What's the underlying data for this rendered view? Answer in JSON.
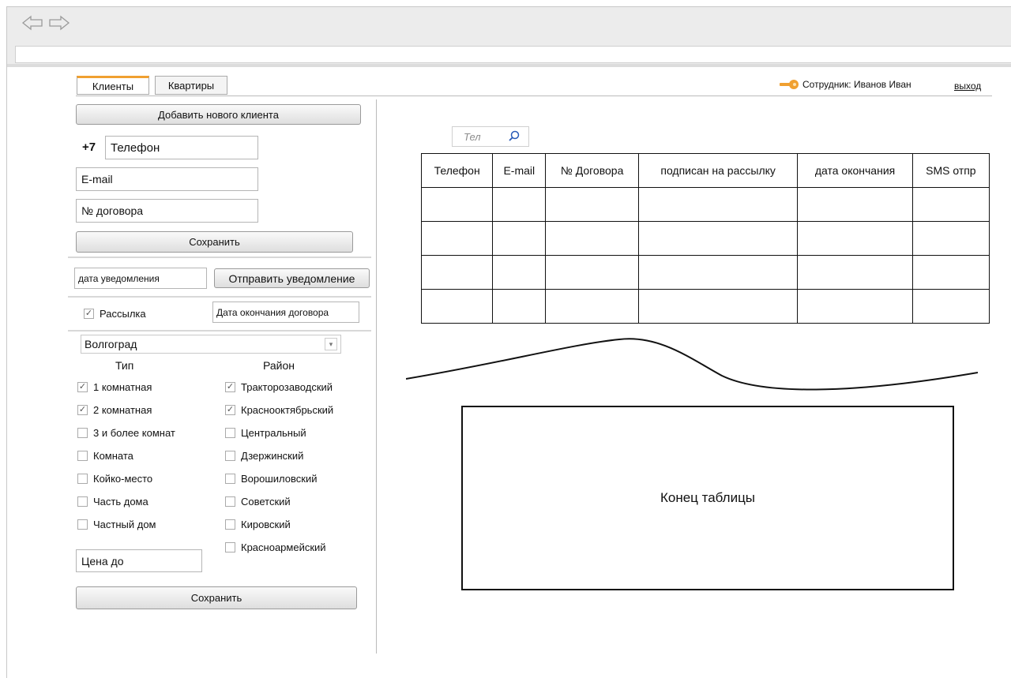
{
  "tabs": {
    "clients": "Клиенты",
    "apartments": "Квартиры"
  },
  "header": {
    "employee": "Сотрудник: Иванов Иван",
    "logout": "выход"
  },
  "client_form": {
    "add_button": "Добавить нового клиента",
    "phone_prefix": "+7",
    "phone_placeholder": "Телефон",
    "email_placeholder": "E-mail",
    "contract_placeholder": "№ договора",
    "save_button": "Сохранить"
  },
  "notify": {
    "date_placeholder": "дата уведомления",
    "send_button": "Отправить уведомление",
    "newsletter_label": "Рассылка",
    "newsletter_checked": true,
    "contract_end_placeholder": "Дата окончания договора"
  },
  "filters": {
    "city": "Волгоград",
    "type_header": "Тип",
    "district_header": "Район",
    "types": [
      {
        "label": "1 комнатная",
        "checked": true
      },
      {
        "label": "2 комнатная",
        "checked": true
      },
      {
        "label": "3 и более комнат",
        "checked": false
      },
      {
        "label": "Комната",
        "checked": false
      },
      {
        "label": "Койко-место",
        "checked": false
      },
      {
        "label": "Часть дома",
        "checked": false
      },
      {
        "label": "Частный дом",
        "checked": false
      }
    ],
    "districts": [
      {
        "label": "Тракторозаводский",
        "checked": true
      },
      {
        "label": "Краснооктябрьский",
        "checked": true
      },
      {
        "label": "Центральный",
        "checked": false
      },
      {
        "label": "Дзержинский",
        "checked": false
      },
      {
        "label": "Ворошиловский",
        "checked": false
      },
      {
        "label": "Советский",
        "checked": false
      },
      {
        "label": "Кировский",
        "checked": false
      },
      {
        "label": "Красноармейский",
        "checked": false
      }
    ],
    "price_placeholder": "Цена до",
    "save_button": "Сохранить"
  },
  "search": {
    "placeholder": "Тел"
  },
  "table": {
    "headers": [
      "Телефон",
      "E-mail",
      "№ Договора",
      "подписан на рассылку",
      "дата окончания",
      "SMS отпр"
    ],
    "empty_rows": 4
  },
  "end_box": {
    "text": "Конец таблицы"
  },
  "colors": {
    "accent": "#f0a030",
    "border": "#111111"
  }
}
